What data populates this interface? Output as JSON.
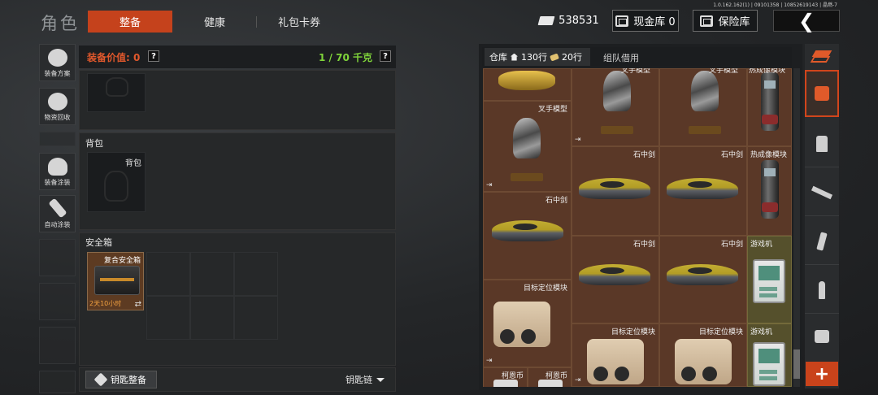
{
  "header": {
    "version": "1.0.162.162(1) | 09101358 | 10852619143 | 晶燃-7",
    "title": "角色",
    "tabs": [
      {
        "label": "整备",
        "active": true
      },
      {
        "label": "健康",
        "active": false
      },
      {
        "label": "礼包卡券",
        "active": false
      }
    ],
    "currency": "538531",
    "cash_vault": "现金库 0",
    "safe_vault": "保险库",
    "back": "❮"
  },
  "sidebar": {
    "items": [
      {
        "label": "装备方案",
        "icon": "gear-icon"
      },
      {
        "label": "物资回收",
        "icon": "recycle-icon"
      },
      {
        "label": "装备涂装",
        "icon": "helmet-icon"
      },
      {
        "label": "自动涂装",
        "icon": "brush-icon"
      }
    ]
  },
  "equipment": {
    "value_label": "装备价值: 0",
    "weight": "1 / 70 千克",
    "help": "?",
    "backpack_section": "背包",
    "backpack_slot": "背包",
    "safe_section": "安全箱",
    "safe_item_name": "复合安全箱",
    "safe_item_timer": "2天10小时",
    "safe_item_swap": "⇄",
    "key_button": "钥匙整备",
    "key_chain": "钥匙链"
  },
  "warehouse": {
    "tab_label": "仓库",
    "rows_total": "130行",
    "rows_used": "20行",
    "team_tab": "组队借用",
    "move_icon": "⇥",
    "items": [
      {
        "name": ""
      },
      {
        "name": "叉手模型"
      },
      {
        "name": "叉手模型"
      },
      {
        "name": "热成像模块"
      },
      {
        "name": "叉手模型"
      },
      {
        "name": "石中剑"
      },
      {
        "name": "石中剑"
      },
      {
        "name": "热成像模块"
      },
      {
        "name": "石中剑"
      },
      {
        "name": "石中剑"
      },
      {
        "name": "石中剑"
      },
      {
        "name": "游戏机"
      },
      {
        "name": "目标定位模块"
      },
      {
        "name": "目标定位模块"
      },
      {
        "name": "目标定位模块"
      },
      {
        "name": "游戏机"
      },
      {
        "name": "柯恩币"
      },
      {
        "name": "柯恩币"
      }
    ]
  },
  "categories": {
    "add": "+",
    "icons": [
      "stack-icon",
      "tactical-icon",
      "vest-icon",
      "rifle-icon",
      "magazine-icon",
      "ammo-icon",
      "misc-icon"
    ]
  },
  "colors": {
    "accent": "#c5421c",
    "value_orange": "#e0582c",
    "weight_green": "#7fd33a",
    "grid_brown": "#5a3827"
  }
}
